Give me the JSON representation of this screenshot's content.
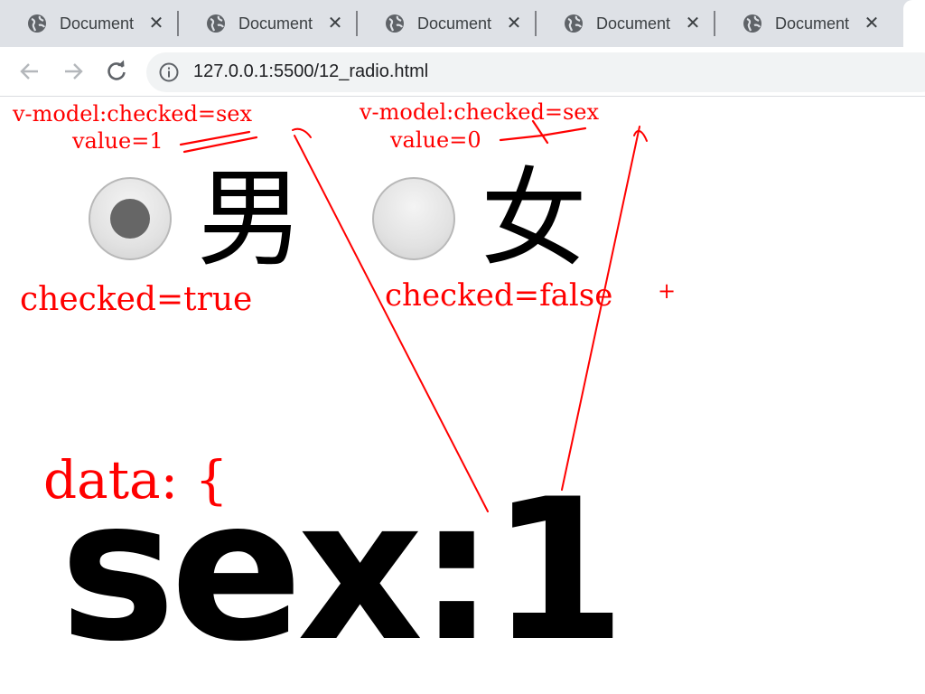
{
  "browser": {
    "tabs": [
      {
        "title": "Document"
      },
      {
        "title": "Document"
      },
      {
        "title": "Document"
      },
      {
        "title": "Document"
      },
      {
        "title": "Document"
      }
    ],
    "tab_close_glyph": "✕",
    "address": {
      "host": "127.0.0.1",
      "path": ":5500/12_radio.html"
    }
  },
  "page": {
    "options": [
      {
        "label": "男",
        "checked": true
      },
      {
        "label": "女",
        "checked": false
      }
    ],
    "output_text": "sex:1"
  },
  "annotations": {
    "male_model": "v-model:checked=sex",
    "male_value": "value=1",
    "female_model": "v-model:checked=sex",
    "female_value": "value=0",
    "male_checked": "checked=true",
    "female_checked": "checked=false",
    "plus_mark": "+",
    "data_open": "data: {"
  },
  "colors": {
    "annotation": "#ff0000",
    "tab_strip": "#dee1e6",
    "radio_dot": "#666666"
  },
  "icons": [
    "globe-icon",
    "close-icon",
    "back-arrow-icon",
    "forward-arrow-icon",
    "reload-icon",
    "info-icon"
  ]
}
